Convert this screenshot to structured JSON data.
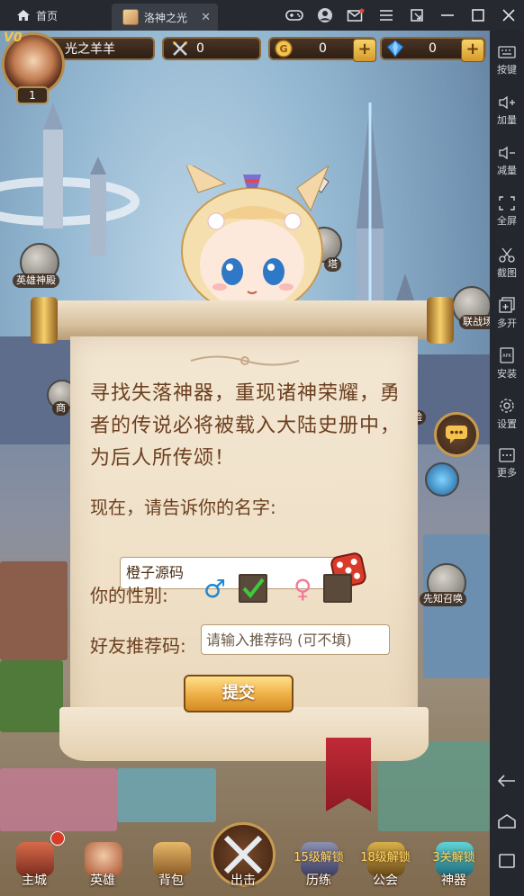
{
  "window": {
    "home_tab": "首页",
    "game_tab": "洛神之光",
    "close_tab": "✕"
  },
  "sidebar": {
    "items": [
      {
        "label": "按键"
      },
      {
        "label": "加量"
      },
      {
        "label": "减量"
      },
      {
        "label": "全屏"
      },
      {
        "label": "截图"
      },
      {
        "label": "多开"
      },
      {
        "label": "安装"
      },
      {
        "label": "设置"
      },
      {
        "label": "更多"
      }
    ]
  },
  "hud": {
    "vip": "V0",
    "player_name": "光之羊羊",
    "level": "1",
    "sword_count": "0",
    "gold": "0",
    "diamond": "0",
    "plus": "+"
  },
  "buildings": {
    "hero_hall": "英雄神殿",
    "tower": "塔",
    "arena": "联战场",
    "shop": "商",
    "trial": "验",
    "summon": "先知召唤"
  },
  "dialog": {
    "intro": "寻找失落神器，重现诸神荣耀，勇者的传说必将被载入大陆史册中，为后人所传颂！",
    "name_prompt": "现在，请告诉你的名字:",
    "name_value": "橙子源码",
    "gender_label": "你的性别:",
    "male_symbol": "♂",
    "female_symbol": "♀",
    "male_selected": true,
    "referral_label": "好友推荐码:",
    "referral_placeholder": "请输入推荐码 (可不填)",
    "submit": "提交"
  },
  "bottom_nav": [
    {
      "label": "主城",
      "lock": ""
    },
    {
      "label": "英雄",
      "lock": ""
    },
    {
      "label": "背包",
      "lock": ""
    },
    {
      "label": "出击",
      "lock": ""
    },
    {
      "label": "历练",
      "lock": "15级解锁"
    },
    {
      "label": "公会",
      "lock": "18级解锁"
    },
    {
      "label": "神器",
      "lock": "3关解锁"
    }
  ],
  "colors": {
    "titlebar": "#26292f",
    "sidebar": "#24272d",
    "paper": "#f3e7d3",
    "text_brown": "#6b3f1f",
    "button_gold": "#f0b24a",
    "ribbon_red": "#c02a37"
  }
}
